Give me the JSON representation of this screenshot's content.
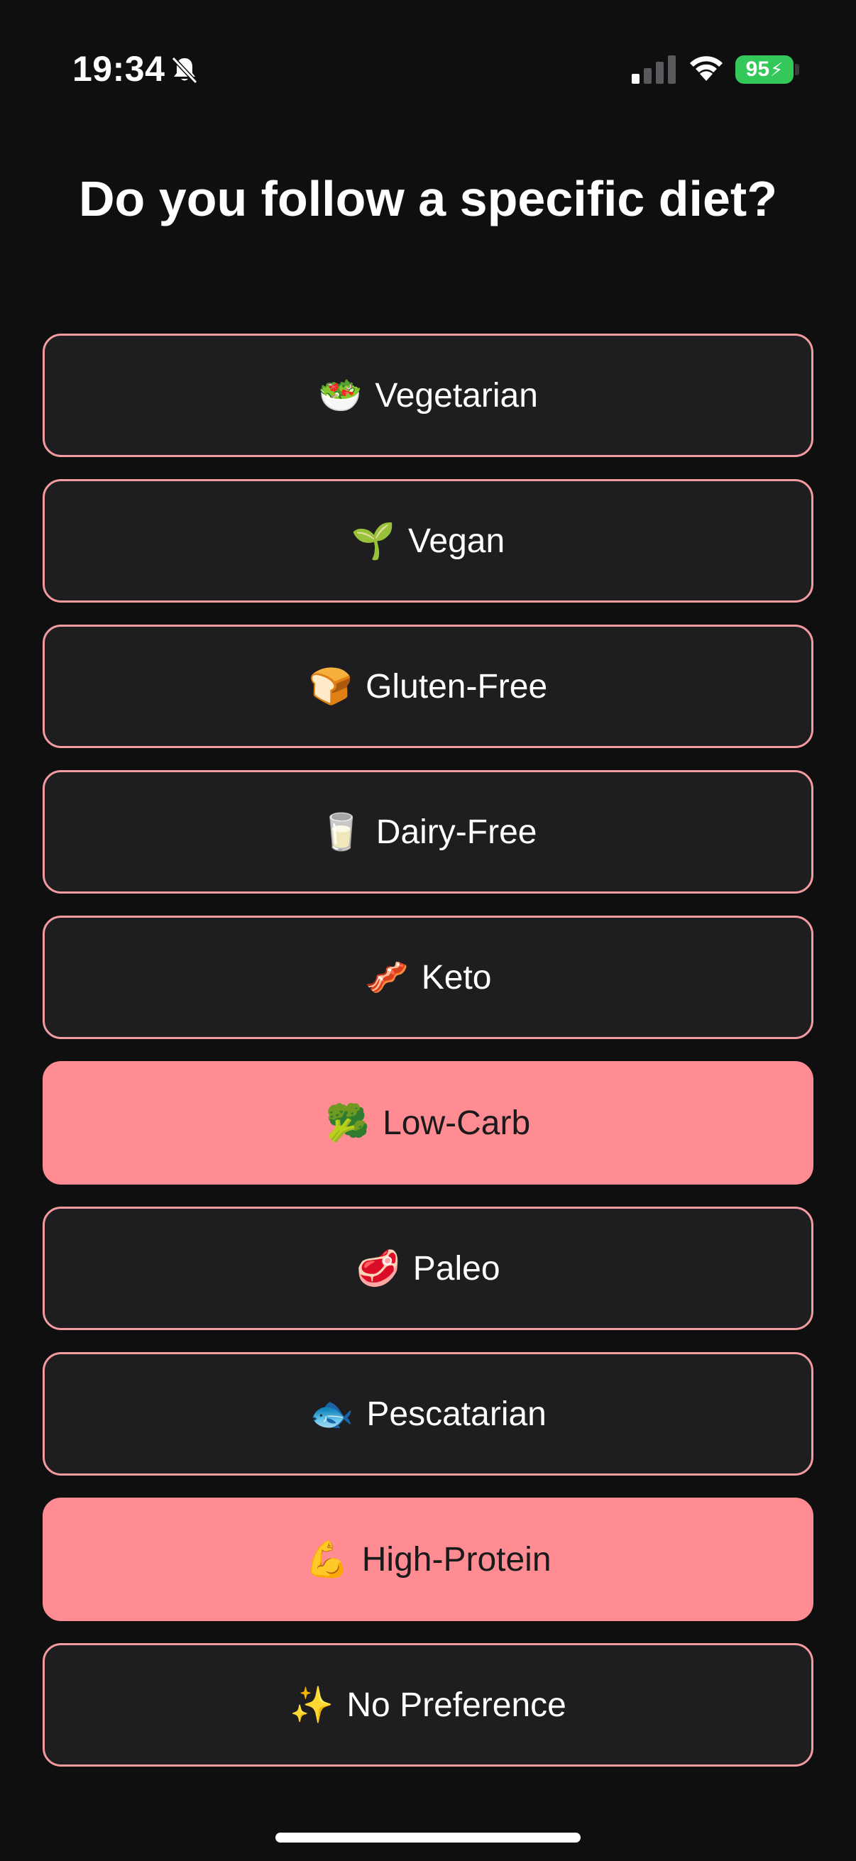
{
  "status_bar": {
    "time": "19:34",
    "battery_level": "95",
    "battery_color": "#34c759"
  },
  "title": "Do you follow a specific diet?",
  "colors": {
    "accent": "#ff8c93",
    "border": "#f39ba0",
    "option_bg": "#1e1e20",
    "background": "#0f0f10"
  },
  "options": [
    {
      "emoji": "🥗",
      "label": "Vegetarian",
      "selected": false
    },
    {
      "emoji": "🌱",
      "label": "Vegan",
      "selected": false
    },
    {
      "emoji": "🍞",
      "label": "Gluten-Free",
      "selected": false
    },
    {
      "emoji": "🥛",
      "label": "Dairy-Free",
      "selected": false
    },
    {
      "emoji": "🥓",
      "label": "Keto",
      "selected": false
    },
    {
      "emoji": "🥦",
      "label": "Low-Carb",
      "selected": true
    },
    {
      "emoji": "🥩",
      "label": "Paleo",
      "selected": false
    },
    {
      "emoji": "🐟",
      "label": "Pescatarian",
      "selected": false
    },
    {
      "emoji": "💪",
      "label": "High-Protein",
      "selected": true
    },
    {
      "emoji": "✨",
      "label": "No Preference",
      "selected": false
    }
  ]
}
